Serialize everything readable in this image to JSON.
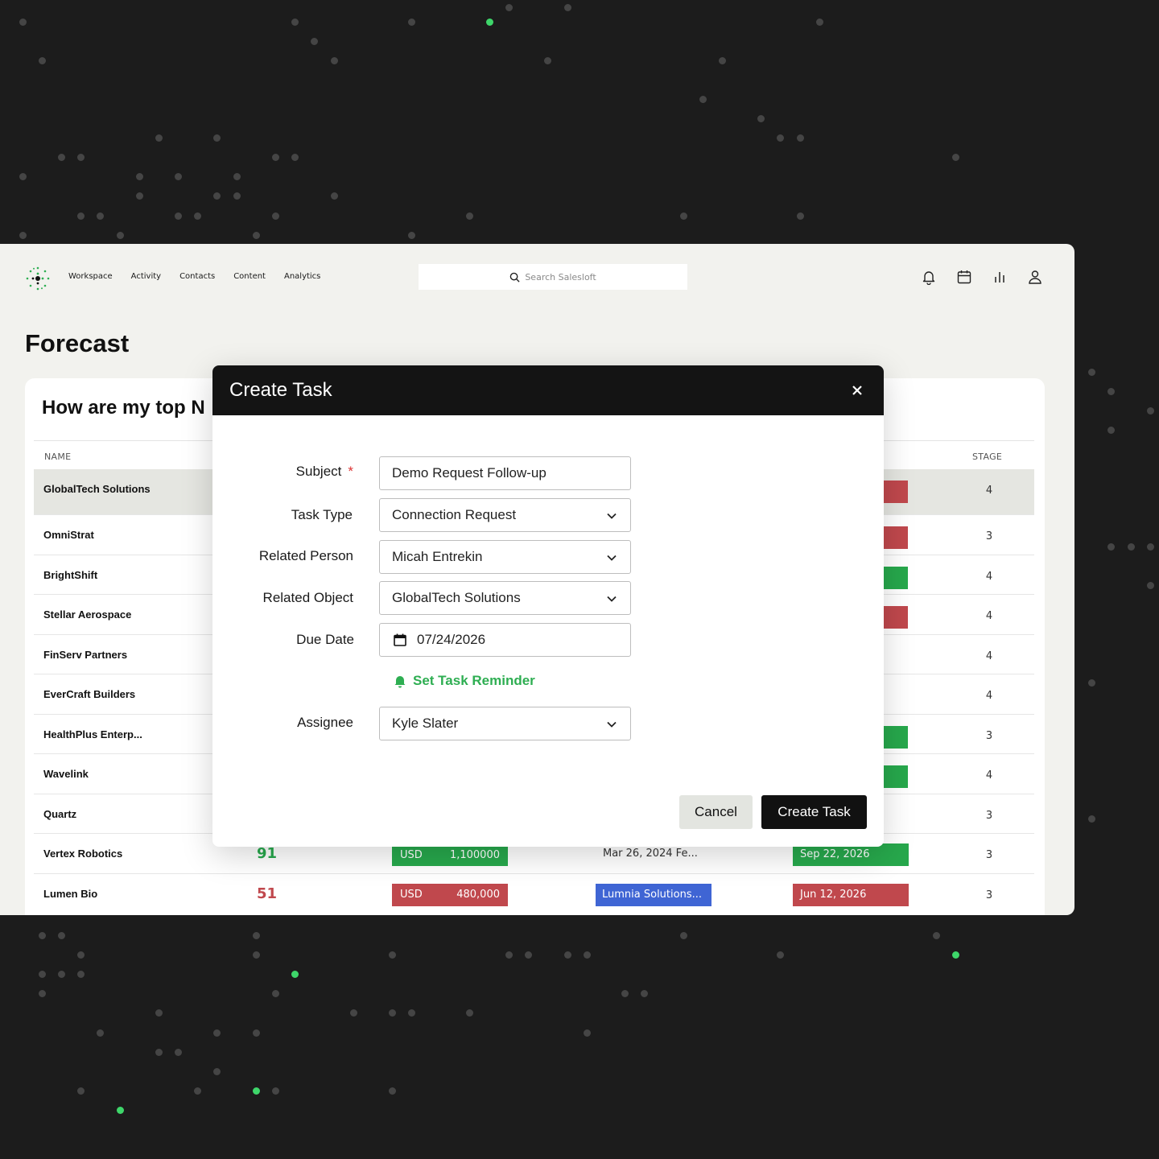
{
  "nav": {
    "links": [
      "Workspace",
      "Activity",
      "Contacts",
      "Content",
      "Analytics"
    ],
    "search_placeholder": "Search Salesloft",
    "icons": [
      "bell-icon",
      "calendar-icon",
      "bar-chart-icon",
      "user-icon"
    ]
  },
  "page": {
    "title": "Forecast",
    "card_title": "How are my top N",
    "columns": {
      "name": "NAME",
      "stage": "STAGE"
    }
  },
  "rows": [
    {
      "name": "GlobalTech Solutions",
      "stage": "4",
      "bar": "red"
    },
    {
      "name": "OmniStrat",
      "stage": "3",
      "bar": "red"
    },
    {
      "name": "BrightShift",
      "stage": "4",
      "bar": "green"
    },
    {
      "name": "Stellar Aerospace",
      "stage": "4",
      "bar": "red"
    },
    {
      "name": "FinServ Partners",
      "stage": "4",
      "bar": ""
    },
    {
      "name": "EverCraft Builders",
      "stage": "4",
      "bar": ""
    },
    {
      "name": "HealthPlus Enterp...",
      "stage": "3",
      "bar": "green"
    },
    {
      "name": "Wavelink",
      "stage": "4",
      "bar": "green"
    },
    {
      "name": "Quartz",
      "stage": "3",
      "bar": ""
    },
    {
      "name": "Vertex Robotics",
      "stage": "3",
      "score": "91",
      "score_color": "#27a84c",
      "currency": "USD",
      "amount": "1,100000",
      "amount_color": "green",
      "activity": "Mar 26, 2024 Fe...",
      "date": "Sep 22, 2026",
      "date_color": "green"
    },
    {
      "name": "Lumen Bio",
      "stage": "3",
      "score": "51",
      "score_color": "#c0484d",
      "currency": "USD",
      "amount": "480,000",
      "amount_color": "red",
      "chip": "Lumnia Solutions...",
      "date": "Jun 12, 2026",
      "date_color": "red"
    }
  ],
  "modal": {
    "title": "Create Task",
    "labels": {
      "subject": "Subject",
      "required": "*",
      "task_type": "Task Type",
      "related_person": "Related Person",
      "related_object": "Related Object",
      "due_date": "Due Date",
      "assignee": "Assignee"
    },
    "values": {
      "subject": "Demo Request Follow-up",
      "task_type": "Connection Request",
      "related_person": "Micah Entrekin",
      "related_object": "GlobalTech Solutions",
      "due_date": "07/24/2026",
      "assignee": "Kyle Slater"
    },
    "reminder": "Set Task Reminder",
    "cancel": "Cancel",
    "create": "Create Task"
  },
  "colors": {
    "accent": "#2eae52",
    "red": "#c0484d",
    "green": "#27a84c",
    "blue": "#3f65d4",
    "dark": "#141414"
  }
}
